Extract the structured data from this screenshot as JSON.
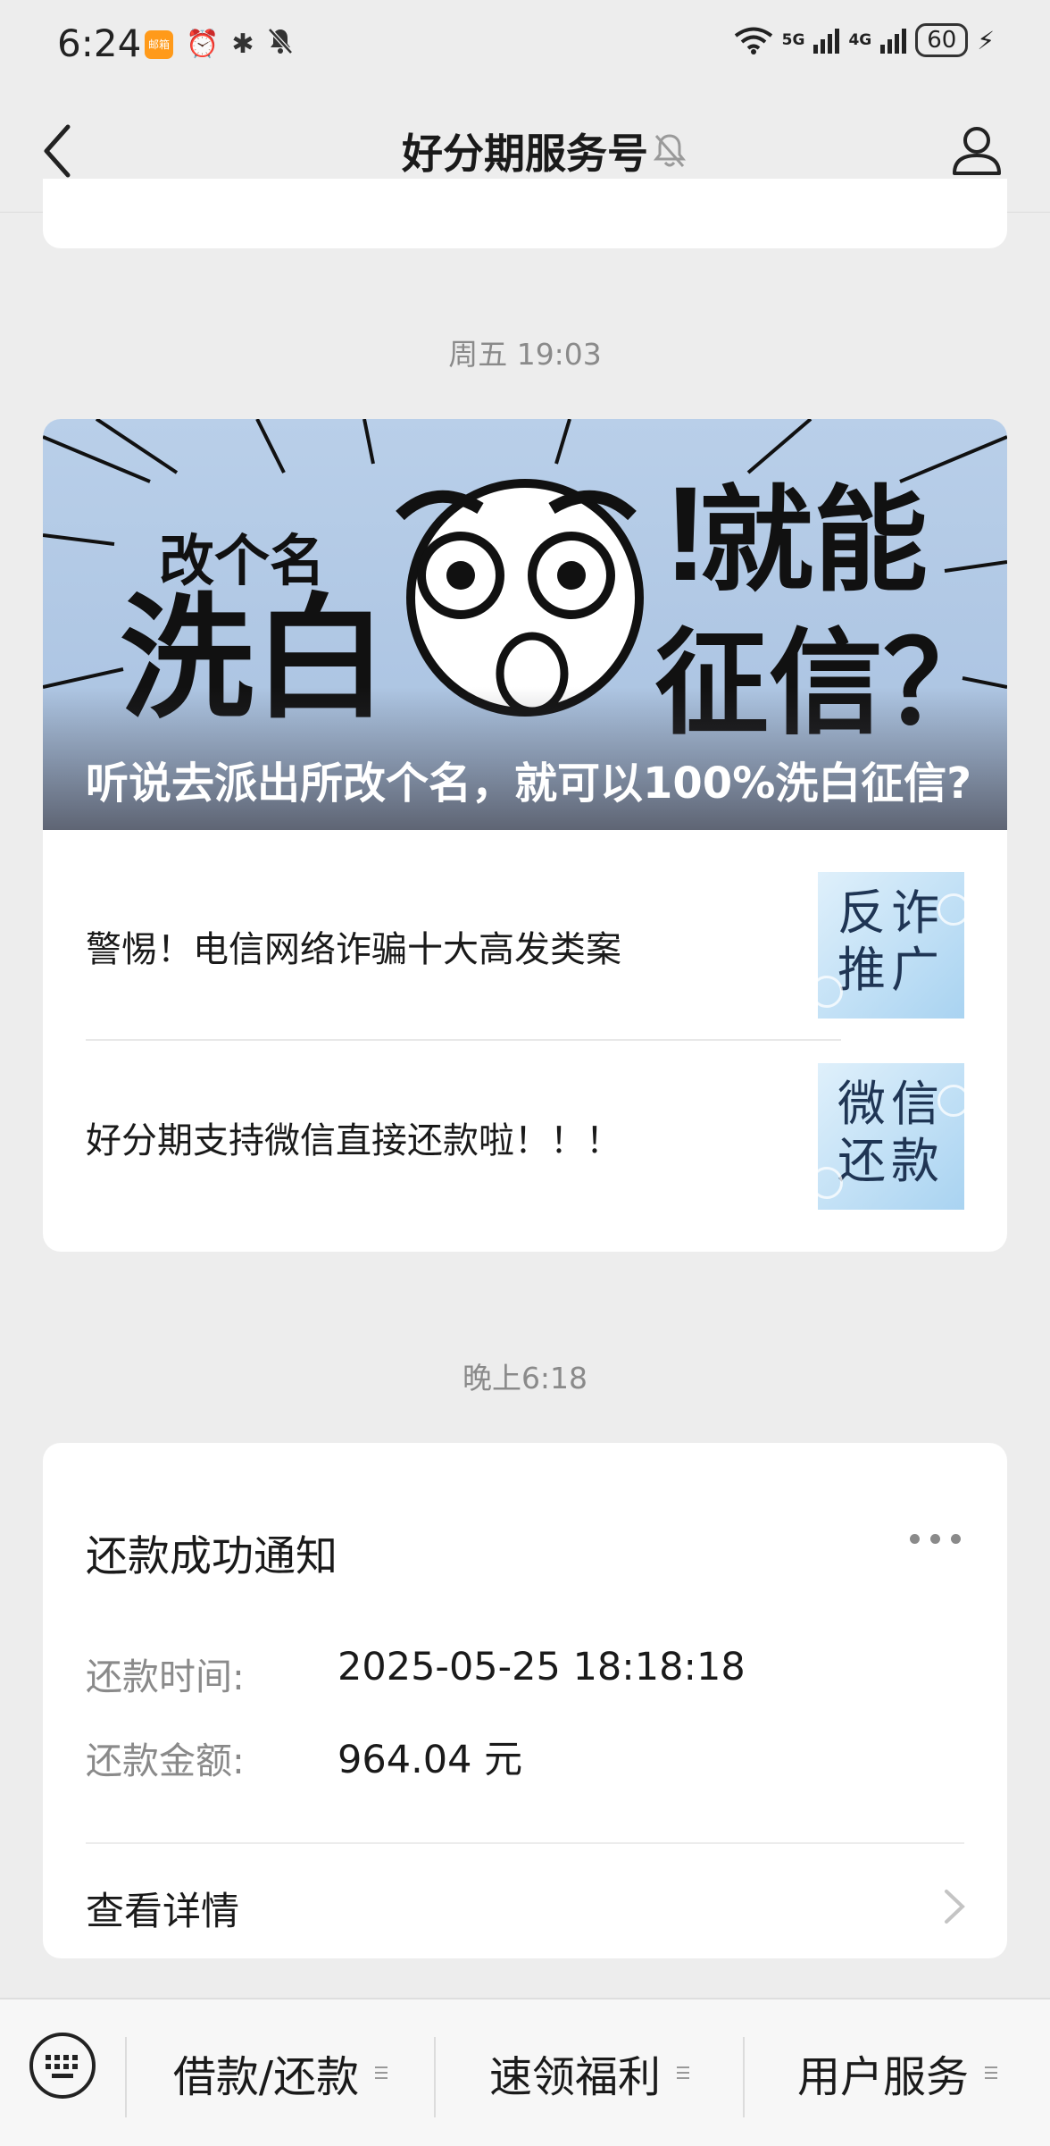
{
  "status_bar": {
    "time": "6:24",
    "app_badge": "邮箱",
    "network_1": "5G",
    "network_2": "4G",
    "battery": "60"
  },
  "header": {
    "title": "好分期服务号",
    "mute_icon": "bell-off-icon",
    "profile_icon": "user-icon"
  },
  "feed": {
    "timestamp_1": "周五 19:03",
    "article": {
      "hero_caption": "听说去派出所改个名，就可以100%洗白征信?",
      "hero_art": {
        "small_text": "改个名",
        "big_left": "洗白",
        "big_right_top": "就能",
        "big_right_bottom": "征信？",
        "bang": "!"
      },
      "items": [
        {
          "title": "警惕！电信网络诈骗十大高发类案",
          "thumb_line1": "反诈",
          "thumb_line2": "推广"
        },
        {
          "title": "好分期支持微信直接还款啦！！！",
          "thumb_line1": "微信",
          "thumb_line2": "还款"
        }
      ]
    },
    "timestamp_2": "晚上6:18",
    "notice": {
      "title": "还款成功通知",
      "rows": [
        {
          "label": "还款时间:",
          "value": "2025-05-25 18:18:18"
        },
        {
          "label": "还款金额:",
          "value": "964.04 元"
        }
      ],
      "detail_link": "查看详情"
    }
  },
  "bottom_bar": {
    "keyboard_icon": "keyboard-icon",
    "menus": [
      "借款/还款",
      "速领福利",
      "用户服务"
    ]
  },
  "colors": {
    "background": "#ededed",
    "card": "#ffffff",
    "muted_text": "#8a8a8a",
    "hero_sky": "#b8cde8"
  }
}
